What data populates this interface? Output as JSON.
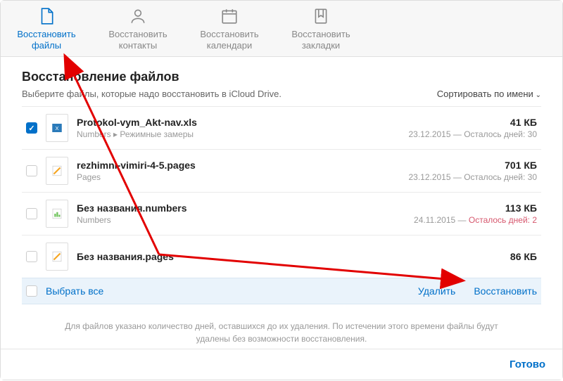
{
  "toolbar": {
    "items": [
      {
        "line1": "Восстановить",
        "line2": "файлы"
      },
      {
        "line1": "Восстановить",
        "line2": "контакты"
      },
      {
        "line1": "Восстановить",
        "line2": "календари"
      },
      {
        "line1": "Восстановить",
        "line2": "закладки"
      }
    ]
  },
  "content": {
    "title": "Восстановление файлов",
    "subtitle": "Выберите файлы, которые надо восстановить в iCloud Drive.",
    "sort_label": "Сортировать по имени"
  },
  "files": [
    {
      "checked": true,
      "name": "Protokol-vym_Akt-nav.xls",
      "path": "Numbers ▸ Режимные замеры",
      "size": "41 КБ",
      "date": "23.12.2015",
      "expire": "Осталось дней: 30",
      "expire_warn": false
    },
    {
      "checked": false,
      "name": "rezhimni-vimiri-4-5.pages",
      "path": "Pages",
      "size": "701 КБ",
      "date": "23.12.2015",
      "expire": "Осталось дней: 30",
      "expire_warn": false
    },
    {
      "checked": false,
      "name": "Без названия.numbers",
      "path": "Numbers",
      "size": "113 КБ",
      "date": "24.11.2015",
      "expire": "Осталось дней: 2",
      "expire_warn": true
    },
    {
      "checked": false,
      "name": "Без названия.pages",
      "path": "",
      "size": "86 КБ",
      "date": "",
      "expire": "",
      "expire_warn": false
    }
  ],
  "action_bar": {
    "select_all": "Выбрать все",
    "delete": "Удалить",
    "restore": "Восстановить"
  },
  "footer_note": "Для файлов указано количество дней, оставшихся до их удаления. По истечении этого времени файлы будут удалены без возможности восстановления.",
  "done": "Готово"
}
